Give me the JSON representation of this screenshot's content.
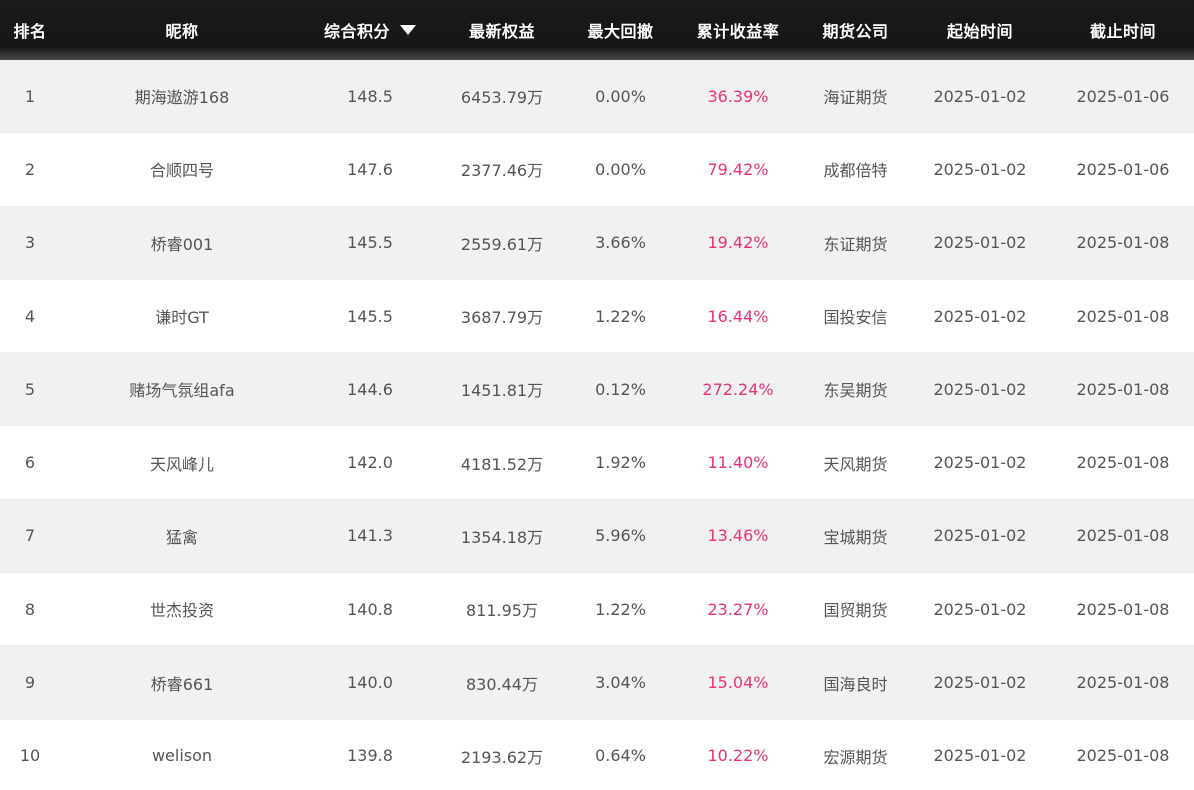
{
  "header": {
    "rank": "排名",
    "nickname": "昵称",
    "score": "综合积分",
    "equity": "最新权益",
    "drawdown": "最大回撤",
    "return": "累计收益率",
    "company": "期货公司",
    "start": "起始时间",
    "end": "截止时间"
  },
  "colors": {
    "return_text": "#e8317b",
    "header_bg": "#161616",
    "row_alt_bg": "#f1f1f1"
  },
  "sort_icon": "triangle-down-icon",
  "rows": [
    {
      "rank": "1",
      "nickname": "期海遨游168",
      "score": "148.5",
      "equity": "6453.79万",
      "drawdown": "0.00%",
      "return": "36.39%",
      "company": "海证期货",
      "start": "2025-01-02",
      "end": "2025-01-06"
    },
    {
      "rank": "2",
      "nickname": "合顺四号",
      "score": "147.6",
      "equity": "2377.46万",
      "drawdown": "0.00%",
      "return": "79.42%",
      "company": "成都倍特",
      "start": "2025-01-02",
      "end": "2025-01-06"
    },
    {
      "rank": "3",
      "nickname": "桥睿001",
      "score": "145.5",
      "equity": "2559.61万",
      "drawdown": "3.66%",
      "return": "19.42%",
      "company": "东证期货",
      "start": "2025-01-02",
      "end": "2025-01-08"
    },
    {
      "rank": "4",
      "nickname": "谦时GT",
      "score": "145.5",
      "equity": "3687.79万",
      "drawdown": "1.22%",
      "return": "16.44%",
      "company": "国投安信",
      "start": "2025-01-02",
      "end": "2025-01-08"
    },
    {
      "rank": "5",
      "nickname": "赌场气氛组afa",
      "score": "144.6",
      "equity": "1451.81万",
      "drawdown": "0.12%",
      "return": "272.24%",
      "company": "东吴期货",
      "start": "2025-01-02",
      "end": "2025-01-08"
    },
    {
      "rank": "6",
      "nickname": "天风峰儿",
      "score": "142.0",
      "equity": "4181.52万",
      "drawdown": "1.92%",
      "return": "11.40%",
      "company": "天风期货",
      "start": "2025-01-02",
      "end": "2025-01-08"
    },
    {
      "rank": "7",
      "nickname": "猛禽",
      "score": "141.3",
      "equity": "1354.18万",
      "drawdown": "5.96%",
      "return": "13.46%",
      "company": "宝城期货",
      "start": "2025-01-02",
      "end": "2025-01-08"
    },
    {
      "rank": "8",
      "nickname": "世杰投资",
      "score": "140.8",
      "equity": "811.95万",
      "drawdown": "1.22%",
      "return": "23.27%",
      "company": "国贸期货",
      "start": "2025-01-02",
      "end": "2025-01-08"
    },
    {
      "rank": "9",
      "nickname": "桥睿661",
      "score": "140.0",
      "equity": "830.44万",
      "drawdown": "3.04%",
      "return": "15.04%",
      "company": "国海良时",
      "start": "2025-01-02",
      "end": "2025-01-08"
    },
    {
      "rank": "10",
      "nickname": "welison",
      "score": "139.8",
      "equity": "2193.62万",
      "drawdown": "0.64%",
      "return": "10.22%",
      "company": "宏源期货",
      "start": "2025-01-02",
      "end": "2025-01-08"
    }
  ]
}
